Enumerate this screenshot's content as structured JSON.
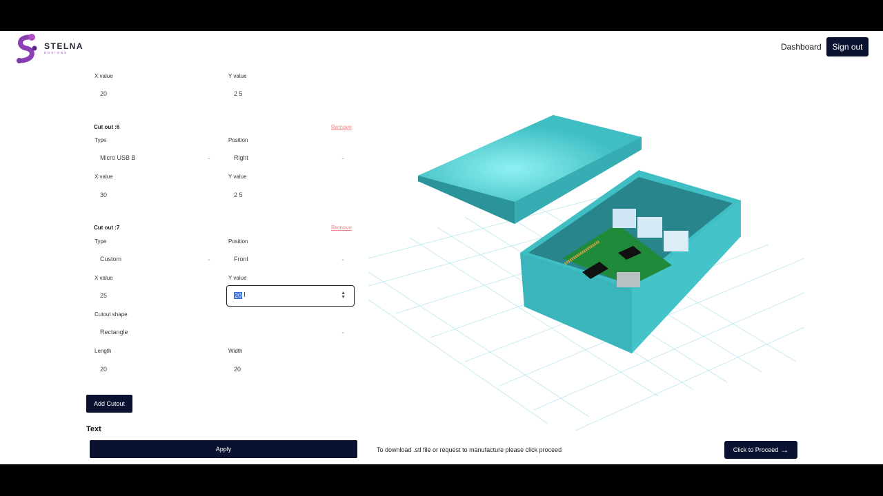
{
  "brand": {
    "name": "STELNA",
    "subtitle": "DESIGNS"
  },
  "nav": {
    "dashboard": "Dashboard",
    "sign_out": "Sign out"
  },
  "form": {
    "cutout5": {
      "x_label": "X value",
      "x_value": "20",
      "y_label": "Y value",
      "y_value": "2 5"
    },
    "cutout6": {
      "title": "Cut out :6",
      "remove": "Remove",
      "type_label": "Type",
      "type_value": "Micro USB B",
      "position_label": "Position",
      "position_value": "Right",
      "x_label": "X value",
      "x_value": "30",
      "y_label": "Y value",
      "y_value": "2 5"
    },
    "cutout7": {
      "title": "Cut out :7",
      "remove": "Remove",
      "type_label": "Type",
      "type_value": "Custom",
      "position_label": "Position",
      "position_value": "Front",
      "x_label": "X value",
      "x_value": "25",
      "y_label": "Y value",
      "y_value": "20",
      "shape_label": "Cutout shape",
      "shape_value": "Rectangle",
      "length_label": "Length",
      "length_value": "20",
      "width_label": "Width",
      "width_value": "20"
    },
    "add_cutout": "Add Cutout",
    "text_heading": "Text",
    "apply": "Apply"
  },
  "footer": {
    "download_message": "To download .stl file or request to manufacture please click proceed",
    "proceed": "Click to Proceed"
  },
  "colors": {
    "primary": "#0b1230",
    "model": "#3fbfc4",
    "remove": "#e88888",
    "selection": "#3b6fd4"
  }
}
